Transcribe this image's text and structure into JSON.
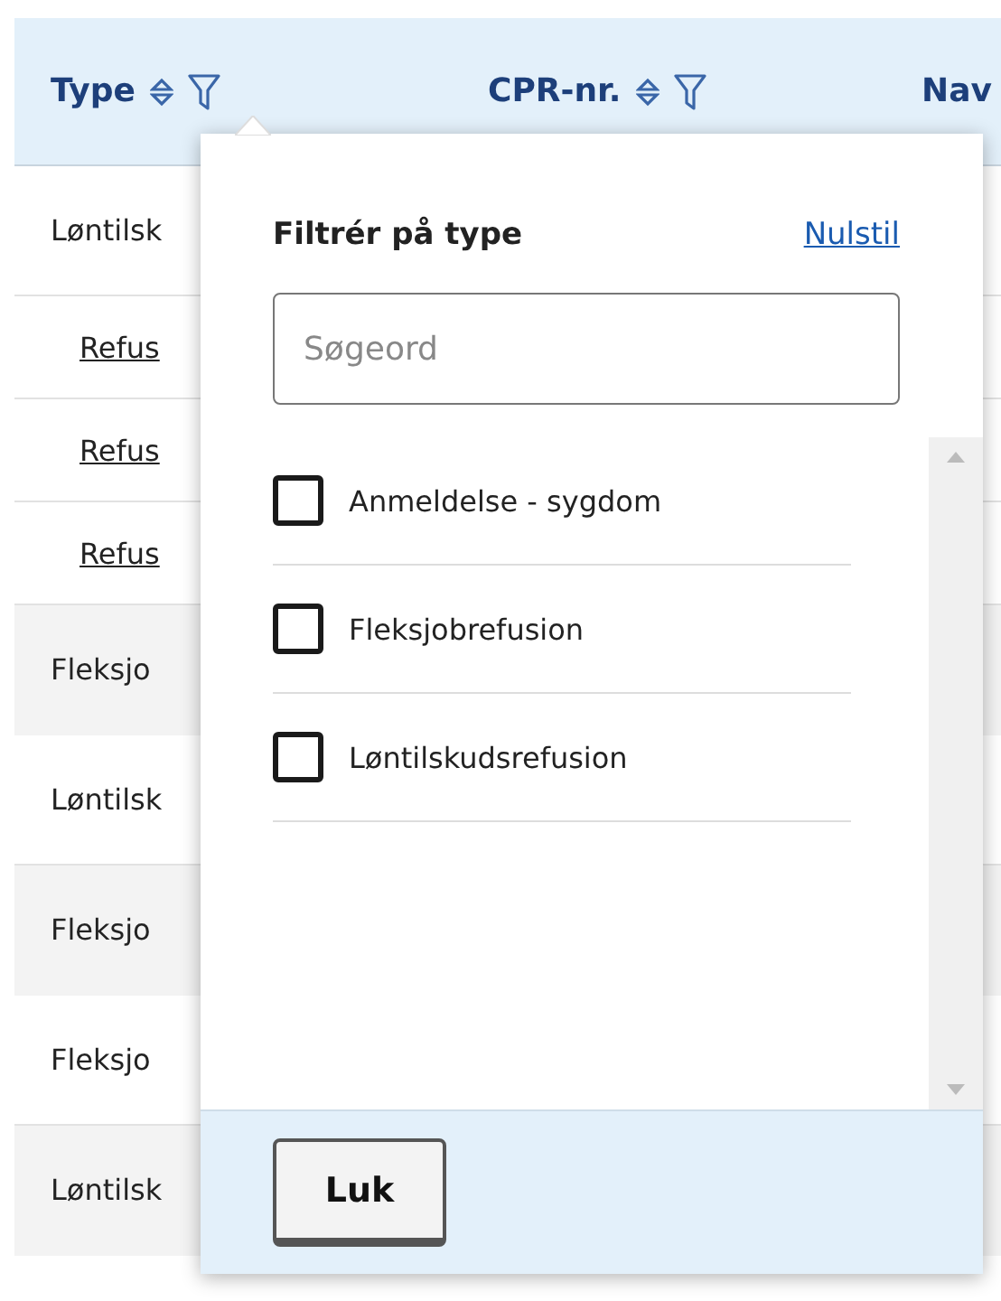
{
  "table": {
    "columns": [
      {
        "label": "Type",
        "sortable": true,
        "filterable": true
      },
      {
        "label": "CPR-nr.",
        "sortable": true,
        "filterable": true
      },
      {
        "label": "Nav"
      }
    ],
    "rows": [
      {
        "type": "Løntilsk",
        "kind": "plain",
        "shaded": false,
        "tall": true
      },
      {
        "type": "Refus",
        "kind": "link",
        "shaded": false,
        "tall": false
      },
      {
        "type": "Refus",
        "kind": "link",
        "shaded": false,
        "tall": false
      },
      {
        "type": "Refus",
        "kind": "link",
        "shaded": false,
        "tall": false
      },
      {
        "type": "Fleksjo",
        "kind": "plain",
        "shaded": true,
        "tall": true
      },
      {
        "type": "Løntilsk",
        "kind": "plain",
        "shaded": false,
        "tall": true
      },
      {
        "type": "Fleksjo",
        "kind": "plain",
        "shaded": true,
        "tall": true
      },
      {
        "type": "Fleksjo",
        "kind": "plain",
        "shaded": false,
        "tall": true
      },
      {
        "type": "Løntilsk",
        "kind": "plain",
        "shaded": true,
        "tall": true
      }
    ]
  },
  "filter_popover": {
    "title": "Filtrér på type",
    "reset_link": "Nulstil",
    "search": {
      "placeholder": "Søgeord"
    },
    "options": [
      {
        "label": "Anmeldelse - sygdom",
        "checked": false
      },
      {
        "label": "Fleksjobrefusion",
        "checked": false
      },
      {
        "label": "Løntilskudsrefusion",
        "checked": false
      }
    ],
    "close_button": "Luk"
  }
}
